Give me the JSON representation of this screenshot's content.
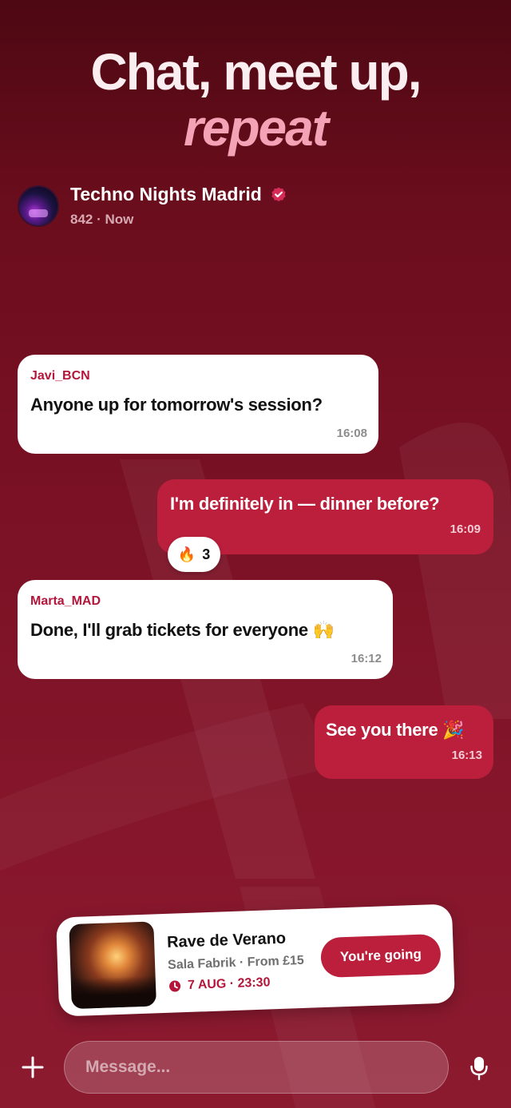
{
  "hero": {
    "line1": "Chat, meet up,",
    "line2": "repeat"
  },
  "group": {
    "name": "Techno Nights Madrid",
    "subtitle": "842 · Now",
    "verified_icon": "verified-check-icon"
  },
  "messages": [
    {
      "direction": "incoming",
      "sender": "Javi_BCN",
      "text": "Anyone up for tomorrow's session?",
      "time": "16:08"
    },
    {
      "direction": "outgoing",
      "text": "I'm definitely in — dinner before?",
      "time": "16:09"
    },
    {
      "direction": "incoming",
      "sender": "Marta_MAD",
      "text": "Done, I'll grab tickets for everyone 🙌",
      "time": "16:12"
    },
    {
      "direction": "outgoing",
      "text": "See you there 🎉",
      "time": "16:13"
    }
  ],
  "reaction": {
    "emoji": "🔥",
    "count": "3"
  },
  "event": {
    "title": "Rave de Verano",
    "venue": "Sala Fabrik · From £15",
    "date": "7 AUG · 23:30",
    "button_label": "You're going"
  },
  "composer": {
    "placeholder": "Message..."
  },
  "colors": {
    "accent": "#bb1f3c",
    "accent_text": "#b3163a",
    "background": "#7a1124",
    "headline_pink": "#f3a3b5"
  }
}
